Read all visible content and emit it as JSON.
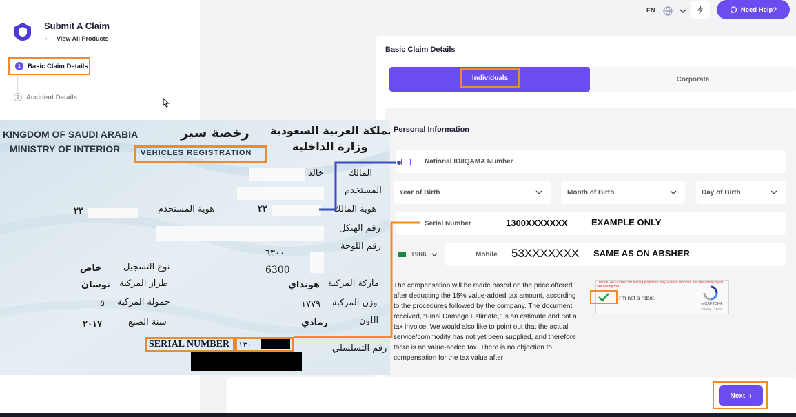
{
  "sidebar": {
    "title": "Submit A Claim",
    "back_link": "View All Products",
    "steps": [
      {
        "number": "1",
        "label": "Basic Claim Details"
      },
      {
        "number": "2",
        "label": "Accident Details"
      }
    ]
  },
  "topbar": {
    "language": "EN",
    "help_label": "Need Help?"
  },
  "form": {
    "title": "Basic Claim Details",
    "tabs": {
      "individuals": "Individuals",
      "corporate": "Corporate"
    },
    "section_title": "Personal Information",
    "national_id_placeholder": "National ID/IQAMA Number",
    "year_of_birth": "Year of Birth",
    "month_of_birth": "Month of Birth",
    "day_of_birth": "Day of Birth",
    "serial_number_label": "Serial Number",
    "country_code": "+966",
    "mobile_label": "Mobile",
    "compensation_text": "The compensation will be made based on the price offered after deducting the 15% value-added tax amount, according to the procedures followed by the company. The document received, “Final Damage Estimate,” is an estimate and not a tax invoice. We would also like to point out that the actual service/commodity has not yet been supplied, and therefore there is no value-added tax. There is no objection to compensation for the tax value after",
    "next_label": "Next"
  },
  "captcha": {
    "warning": "This reCAPTCHA is for testing purposes only. Please report to the site admin if you are seeing this.",
    "label": "I'm not a robot",
    "brand": "reCAPTCHA",
    "terms": "Privacy - Terms"
  },
  "annotations": {
    "serial_value": "1300XXXXXXX",
    "serial_note": "EXAMPLE ONLY",
    "mobile_value": "53XXXXXXX",
    "mobile_note": "SAME AS ON ABSHER",
    "highlight_color": "#f08a2a",
    "connector_blue": "#3a4bc4"
  },
  "vehicle_registration": {
    "country_en": "KINGDOM OF SAUDI ARABIA",
    "ministry_en": "MINISTRY OF INTERIOR",
    "doc_type_en": "VEHICLES REGISTRATION",
    "doc_type_ar": "رخصة سير",
    "country_ar": "المملكة العربية السعودية",
    "ministry_ar": "وزارة الداخلية",
    "owner_label": "المالك",
    "owner_value": "خالد",
    "user_label": "المستخدم",
    "owner_id_label": "هوية المالك",
    "owner_id_value": "٢٣",
    "user_id_label": "هوية المستخدم",
    "user_id_value": "٢٣",
    "chassis_label": "رقم الهيكل",
    "plate_label": "رقم اللوحة",
    "plate_value_ar": "٦٣٠٠",
    "plate_value": "6300",
    "registration_type_label": "نوع التسجيل",
    "registration_type_value": "خاص",
    "model_label": "طراز المركبة",
    "model_value": "توسان",
    "make_label": "ماركة المركبة",
    "make_value": "هونداي",
    "capacity_label": "حمولة المركبة",
    "capacity_value": "٥",
    "weight_label": "وزن المركبة",
    "weight_value": "١٧٧٩",
    "year_label": "سنة الصنع",
    "year_value": "٢٠١٧",
    "color_label": "اللون",
    "color_value": "رمادي",
    "serial_label_ar": "رقم التسلسلي",
    "serial_label_en": "SERIAL NUMBER",
    "serial_value_ar": "١٣٠٠"
  }
}
